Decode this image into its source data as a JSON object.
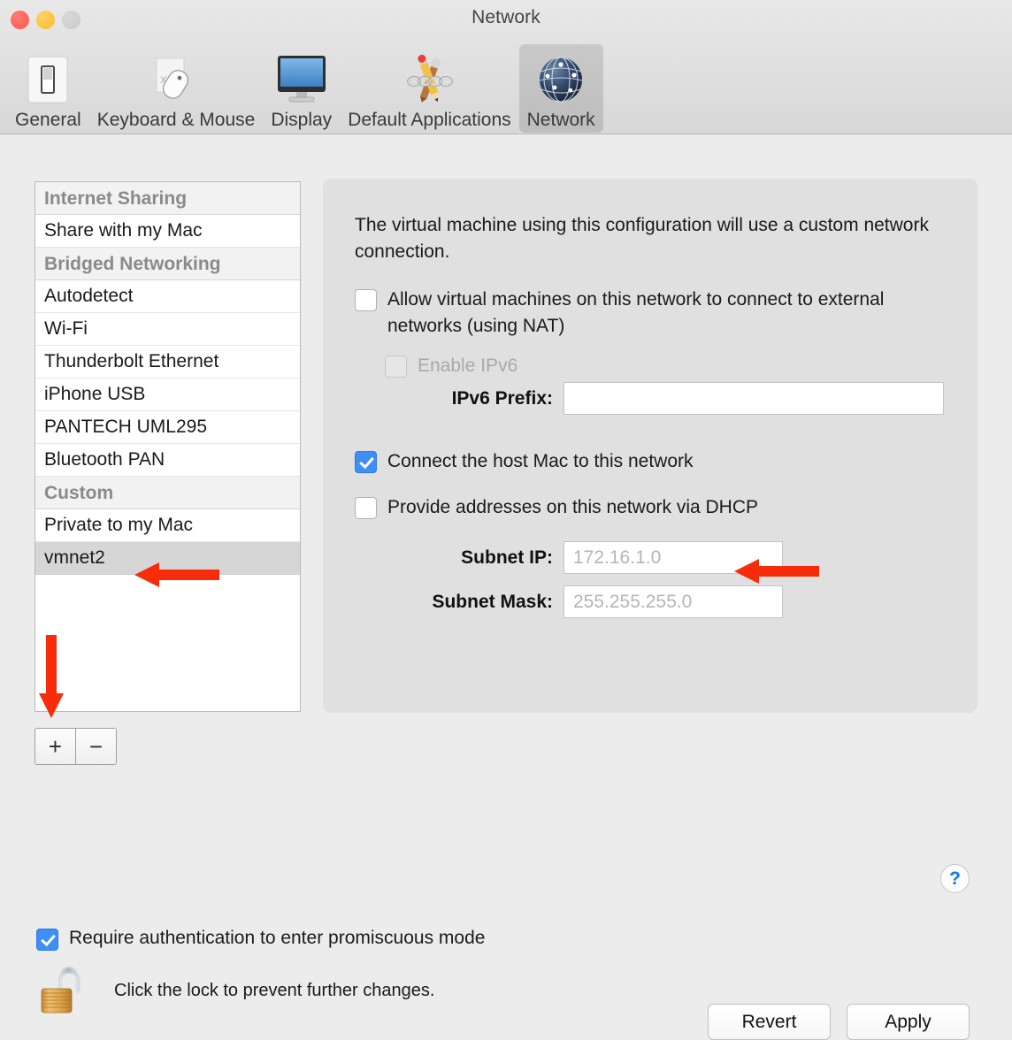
{
  "window": {
    "title": "Network",
    "traffic_lights": [
      "close",
      "minimize",
      "zoom"
    ]
  },
  "toolbar": {
    "items": [
      {
        "label": "General",
        "icon": "light-switch-icon",
        "selected": false
      },
      {
        "label": "Keyboard & Mouse",
        "icon": "mouse-icon",
        "selected": false
      },
      {
        "label": "Display",
        "icon": "display-monitor-icon",
        "selected": false
      },
      {
        "label": "Default Applications",
        "icon": "pencil-ruler-chain-icon",
        "selected": false
      },
      {
        "label": "Network",
        "icon": "globe-network-icon",
        "selected": true
      }
    ]
  },
  "network_list": {
    "groups": [
      {
        "header": "Internet Sharing",
        "items": [
          {
            "label": "Share with my Mac",
            "selected": false
          }
        ]
      },
      {
        "header": "Bridged Networking",
        "items": [
          {
            "label": "Autodetect",
            "selected": false
          },
          {
            "label": "Wi-Fi",
            "selected": false
          },
          {
            "label": "Thunderbolt Ethernet",
            "selected": false
          },
          {
            "label": "iPhone USB",
            "selected": false
          },
          {
            "label": "PANTECH UML295",
            "selected": false
          },
          {
            "label": "Bluetooth PAN",
            "selected": false
          }
        ]
      },
      {
        "header": "Custom",
        "items": [
          {
            "label": "Private to my Mac",
            "selected": false
          },
          {
            "label": "vmnet2",
            "selected": true
          }
        ]
      }
    ],
    "add_button": "+",
    "remove_button": "−"
  },
  "panel": {
    "description": "The virtual machine using this configuration will use a custom network connection.",
    "nat_checkbox": {
      "label": "Allow virtual machines on this network to connect to external networks (using NAT)",
      "checked": false,
      "disabled": false
    },
    "ipv6_checkbox": {
      "label": "Enable IPv6",
      "checked": false,
      "disabled": true
    },
    "ipv6_prefix": {
      "label": "IPv6 Prefix:",
      "value": "",
      "placeholder": ""
    },
    "connect_host_checkbox": {
      "label": "Connect the host Mac to this network",
      "checked": true,
      "disabled": false
    },
    "dhcp_checkbox": {
      "label": "Provide addresses on this network via DHCP",
      "checked": false,
      "disabled": false
    },
    "subnet_ip": {
      "label": "Subnet IP:",
      "value": "172.16.1.0"
    },
    "subnet_mask": {
      "label": "Subnet Mask:",
      "value": "255.255.255.0"
    }
  },
  "help_button": {
    "label": "?"
  },
  "footer": {
    "promiscuous_checkbox": {
      "label": "Require authentication to enter promiscuous mode",
      "checked": true
    },
    "lock_icon": "open-padlock-icon",
    "lock_text": "Click the lock to prevent further changes.",
    "revert_button": "Revert",
    "apply_button": "Apply"
  },
  "annotations": {
    "color": "#F62C0B",
    "arrows": [
      {
        "name": "arrow-pointing-to-vmnet2",
        "direction": "left"
      },
      {
        "name": "arrow-pointing-to-add-button",
        "direction": "down"
      },
      {
        "name": "arrow-pointing-to-subnet-ip",
        "direction": "left"
      }
    ]
  }
}
